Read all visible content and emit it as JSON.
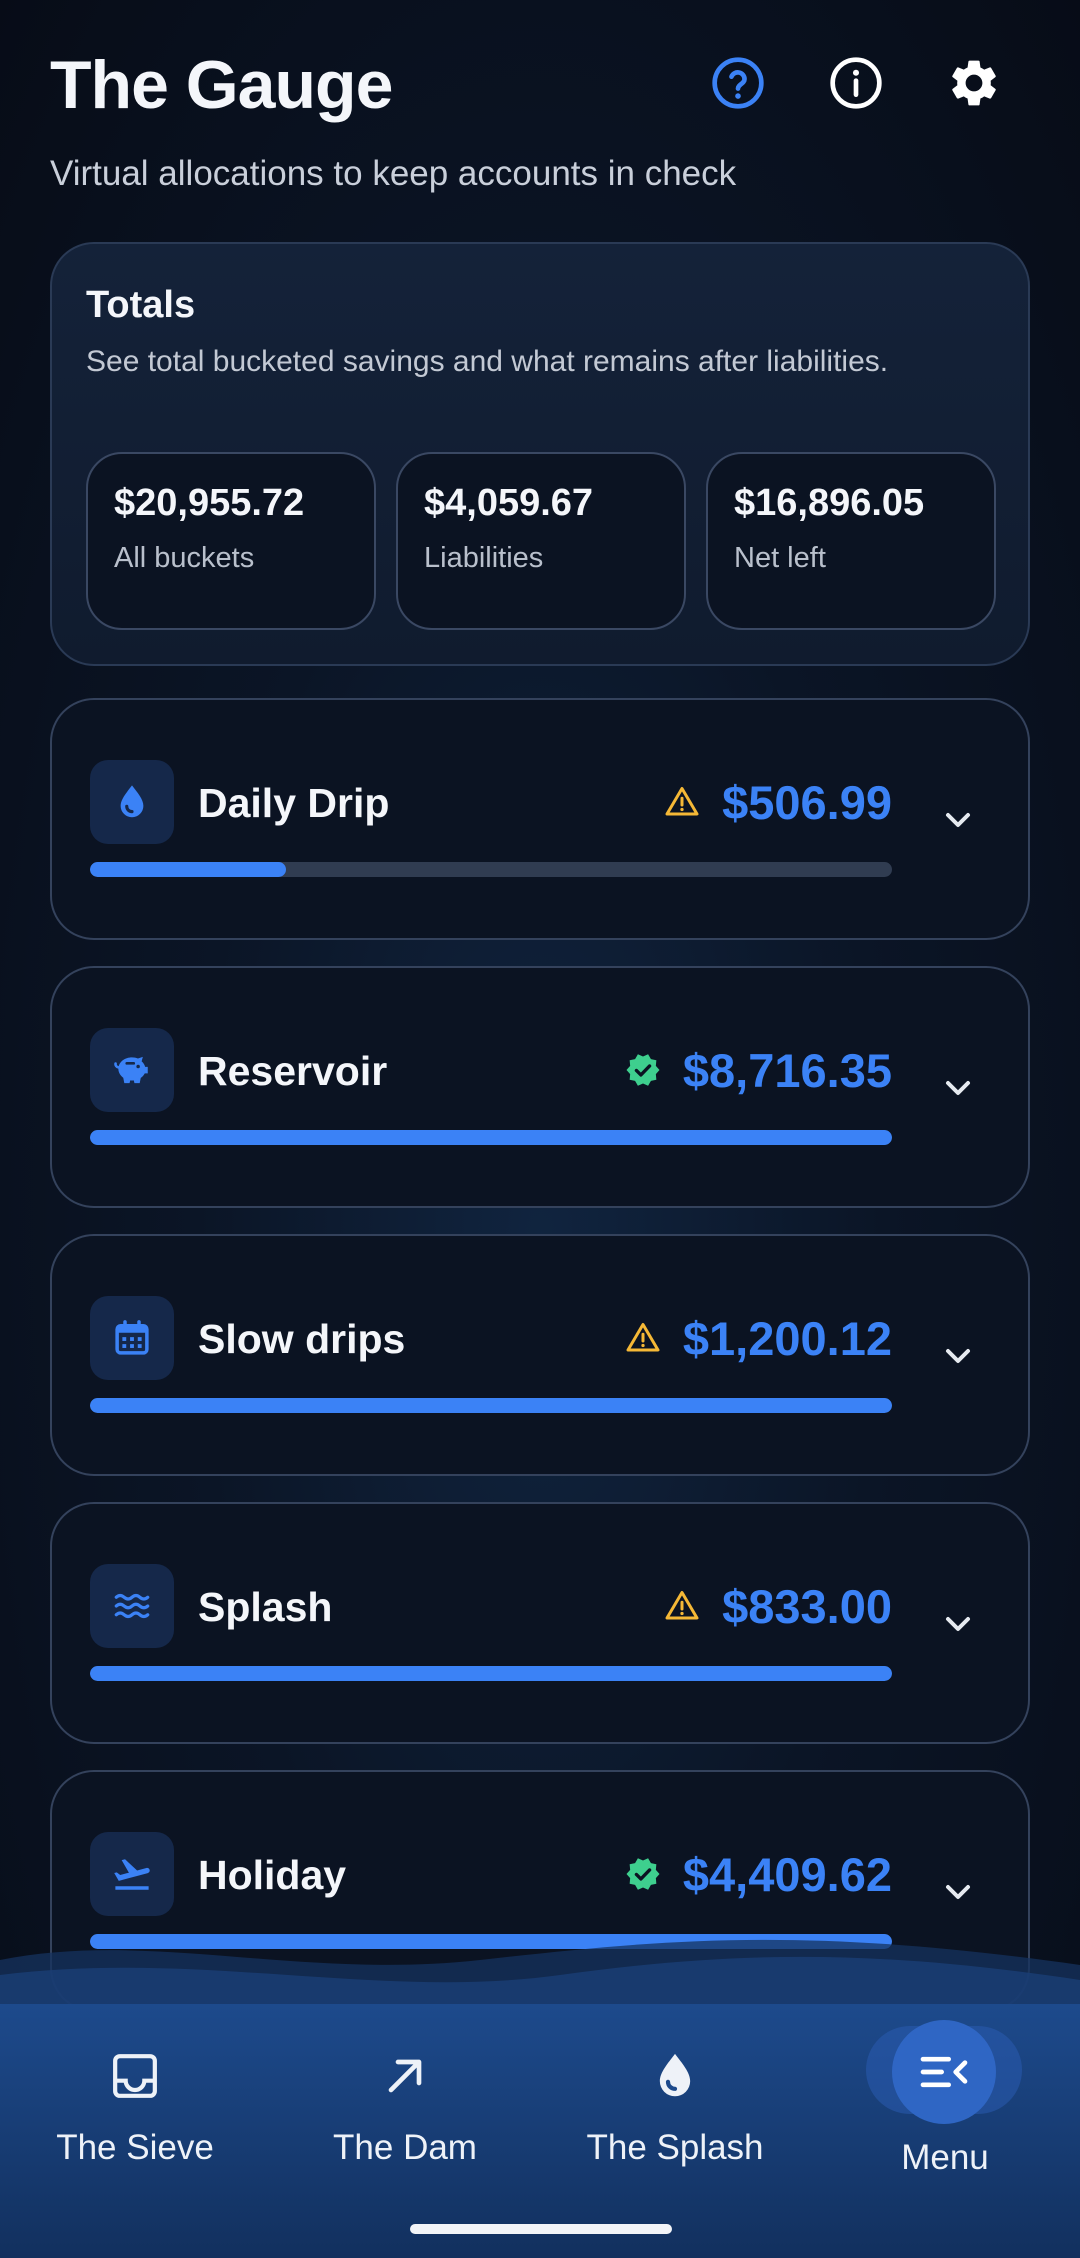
{
  "header": {
    "title": "The Gauge",
    "subtitle": "Virtual allocations to keep accounts in check",
    "icons": [
      "help-icon",
      "info-icon",
      "settings-icon"
    ]
  },
  "totals": {
    "title": "Totals",
    "description": "See total bucketed savings and what remains after liabilities.",
    "stats": [
      {
        "value": "$20,955.72",
        "label": "All buckets"
      },
      {
        "value": "$4,059.67",
        "label": "Liabilities"
      },
      {
        "value": "$16,896.05",
        "label": "Net left"
      }
    ]
  },
  "buckets": [
    {
      "name": "Daily Drip",
      "amount": "$506.99",
      "status": "warning",
      "icon": "drop-icon",
      "progress": 0.245
    },
    {
      "name": "Reservoir",
      "amount": "$8,716.35",
      "status": "verified",
      "icon": "piggy-bank-icon",
      "progress": 1.0
    },
    {
      "name": "Slow drips",
      "amount": "$1,200.12",
      "status": "warning",
      "icon": "calendar-icon",
      "progress": 1.0
    },
    {
      "name": "Splash",
      "amount": "$833.00",
      "status": "warning",
      "icon": "waves-icon",
      "progress": 1.0
    },
    {
      "name": "Holiday",
      "amount": "$4,409.62",
      "status": "verified",
      "icon": "flight-icon",
      "progress": 1.0
    }
  ],
  "nav": {
    "items": [
      {
        "label": "The Sieve",
        "icon": "inbox-icon"
      },
      {
        "label": "The Dam",
        "icon": "arrow-up-right-icon"
      },
      {
        "label": "The Splash",
        "icon": "drop-icon"
      }
    ],
    "menu_label": "Menu"
  },
  "colors": {
    "accent": "#3b82f6",
    "warning": "#f5b836",
    "success": "#3ecf8e",
    "background": "#0b1322",
    "nav": "#1d4a8c"
  }
}
